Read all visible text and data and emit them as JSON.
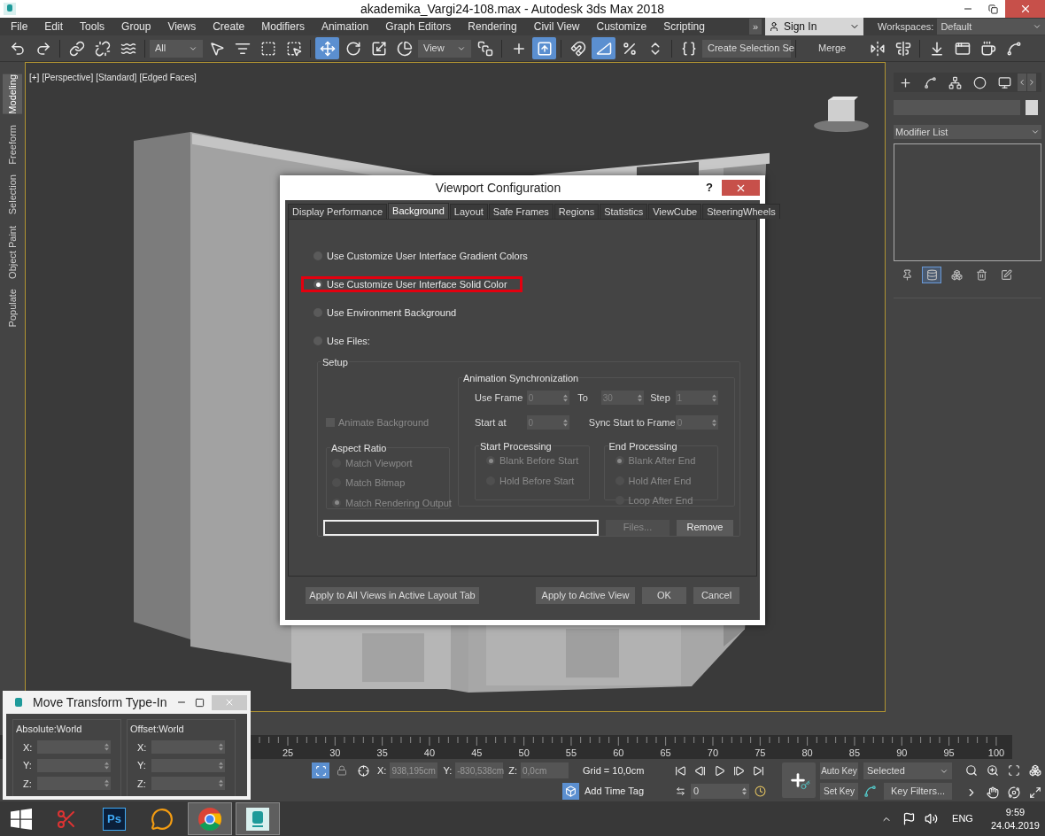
{
  "window": {
    "title": "akademika_Vargi24-108.max - Autodesk 3ds Max 2018"
  },
  "menu": [
    "File",
    "Edit",
    "Tools",
    "Group",
    "Views",
    "Create",
    "Modifiers",
    "Animation",
    "Graph Editors",
    "Rendering",
    "Civil View",
    "Customize",
    "Scripting"
  ],
  "menu_overflow": "»",
  "sign_in": "Sign In",
  "workspaces": {
    "label": "Workspaces:",
    "value": "Default"
  },
  "toolbar": [
    {
      "kind": "undo",
      "selected": false
    },
    {
      "kind": "redo",
      "selected": false
    },
    {
      "kind": "sep"
    },
    {
      "kind": "link",
      "selected": false
    },
    {
      "kind": "unlink",
      "selected": false
    },
    {
      "kind": "bind",
      "selected": false
    },
    {
      "kind": "sep"
    },
    {
      "kind": "dropdown",
      "value": "All",
      "selected": false
    },
    {
      "kind": "select",
      "selected": false
    },
    {
      "kind": "select_by_name",
      "selected": false
    },
    {
      "kind": "region",
      "selected": false
    },
    {
      "kind": "crossing",
      "selected": false
    },
    {
      "kind": "sep"
    },
    {
      "kind": "move",
      "selected": true
    },
    {
      "kind": "rotate",
      "selected": false
    },
    {
      "kind": "scale",
      "selected": false
    },
    {
      "kind": "placement",
      "selected": false
    },
    {
      "kind": "dropdown",
      "value": "View",
      "selected": false
    },
    {
      "kind": "pivot",
      "selected": false
    },
    {
      "kind": "sep"
    },
    {
      "kind": "shortcut",
      "selected": false
    },
    {
      "kind": "manipulate",
      "selected": true
    },
    {
      "kind": "sep"
    },
    {
      "kind": "snap",
      "selected": false
    },
    {
      "kind": "angle_snap",
      "selected": true
    },
    {
      "kind": "percent_snap",
      "selected": false
    },
    {
      "kind": "spinner_snap",
      "selected": false
    },
    {
      "kind": "sep"
    },
    {
      "kind": "named_sets",
      "selected": false
    },
    {
      "kind": "dropdown",
      "value": "Create Selection Se",
      "selected": false
    },
    {
      "kind": "sep"
    },
    {
      "kind": "text",
      "value": "Merge",
      "selected": false
    },
    {
      "kind": "mirror",
      "selected": false
    },
    {
      "kind": "align",
      "selected": false
    },
    {
      "kind": "sep"
    },
    {
      "kind": "import",
      "selected": false
    },
    {
      "kind": "render_setup",
      "selected": false
    },
    {
      "kind": "render",
      "selected": false
    },
    {
      "kind": "curve",
      "selected": false
    }
  ],
  "ribbon_tabs": [
    {
      "label": "Modeling",
      "selected": true
    },
    {
      "label": "Freeform",
      "selected": false
    },
    {
      "label": "Selection",
      "selected": false
    },
    {
      "label": "Object Paint",
      "selected": false
    },
    {
      "label": "Populate",
      "selected": false
    }
  ],
  "viewport": {
    "labels": [
      "[+]",
      "[Perspective]",
      "[Standard]",
      "[Edged Faces]"
    ]
  },
  "command_panel": {
    "modifier_list": "Modifier List",
    "stack_tools": [
      {
        "kind": "pin",
        "selected": false
      },
      {
        "kind": "show_end",
        "selected": true
      },
      {
        "kind": "unique",
        "selected": false
      },
      {
        "kind": "remove",
        "selected": false
      },
      {
        "kind": "configure",
        "selected": false
      }
    ]
  },
  "dialog": {
    "title": "Viewport Configuration",
    "help": "?",
    "tabs": [
      {
        "label": "Display Performance",
        "selected": false
      },
      {
        "label": "Background",
        "selected": true
      },
      {
        "label": "Layout",
        "selected": false
      },
      {
        "label": "Safe Frames",
        "selected": false
      },
      {
        "label": "Regions",
        "selected": false
      },
      {
        "label": "Statistics",
        "selected": false
      },
      {
        "label": "ViewCube",
        "selected": false
      },
      {
        "label": "SteeringWheels",
        "selected": false
      }
    ],
    "options": [
      {
        "label": "Use Customize User Interface Gradient Colors",
        "selected": false,
        "highlighted": false
      },
      {
        "label": "Use Customize User Interface Solid Color",
        "selected": true,
        "highlighted": true
      },
      {
        "label": "Use Environment Background",
        "selected": false,
        "highlighted": false
      },
      {
        "label": "Use Files:",
        "selected": false,
        "highlighted": false
      }
    ],
    "setup": {
      "title": "Setup",
      "animate_background": {
        "label": "Animate Background",
        "checked": false,
        "disabled": true
      },
      "aspect_ratio": {
        "title": "Aspect Ratio",
        "disabled": true,
        "options": [
          {
            "label": "Match Viewport",
            "selected": false
          },
          {
            "label": "Match Bitmap",
            "selected": false
          },
          {
            "label": "Match Rendering Output",
            "selected": true
          }
        ]
      },
      "sync": {
        "title": "Animation Synchronization",
        "disabled": true,
        "fields": [
          {
            "label": "Use Frame",
            "value": "0"
          },
          {
            "label": "To",
            "value": "30"
          },
          {
            "label": "Step",
            "value": "1"
          },
          {
            "label": "Start at",
            "value": "0"
          },
          {
            "label": "Sync Start to Frame",
            "value": "0"
          }
        ]
      },
      "start_processing": {
        "title": "Start Processing",
        "disabled": true,
        "options": [
          {
            "label": "Blank Before Start",
            "selected": true
          },
          {
            "label": "Hold Before Start",
            "selected": false
          }
        ]
      },
      "end_processing": {
        "title": "End Processing",
        "disabled": true,
        "options": [
          {
            "label": "Blank After End",
            "selected": true
          },
          {
            "label": "Hold After End",
            "selected": false
          },
          {
            "label": "Loop After End",
            "selected": false
          }
        ]
      },
      "files_button": {
        "label": "Files...",
        "disabled": true
      },
      "remove_button": {
        "label": "Remove",
        "disabled": false
      }
    },
    "buttons": [
      "Apply to All Views in Active Layout Tab",
      "Apply to Active View",
      "OK",
      "Cancel"
    ]
  },
  "move_type_in": {
    "title": "Move Transform Type-In",
    "groups": [
      {
        "title": "Absolute:World",
        "axes": [
          "X:",
          "Y:",
          "Z:"
        ]
      },
      {
        "title": "Offset:World",
        "axes": [
          "X:",
          "Y:",
          "Z:"
        ]
      }
    ]
  },
  "timeline": {
    "ticks": [
      "25",
      "30",
      "35",
      "40",
      "45",
      "50",
      "55",
      "60",
      "65",
      "70",
      "75",
      "80",
      "85",
      "90",
      "95",
      "100"
    ]
  },
  "status": {
    "coords": [
      {
        "axis": "X:",
        "value": "938,195cm"
      },
      {
        "axis": "Y:",
        "value": "-830,538cm"
      },
      {
        "axis": "Z:",
        "value": "0,0cm"
      }
    ],
    "grid": "Grid = 10,0cm",
    "add_time_tag": "Add Time Tag",
    "frame": "0",
    "auto_key": "Auto Key",
    "key_mode": "Selected",
    "set_key": "Set Key",
    "key_filters": "Key Filters..."
  },
  "taskbar": {
    "apps": [
      {
        "kind": "snipping",
        "active": false
      },
      {
        "kind": "photoshop",
        "label": "Ps",
        "active": false
      },
      {
        "kind": "chat",
        "active": false
      },
      {
        "kind": "chrome",
        "active": true
      },
      {
        "kind": "max",
        "active": true
      }
    ],
    "language": "ENG",
    "time": "9:59",
    "date": "24.04.2019"
  }
}
